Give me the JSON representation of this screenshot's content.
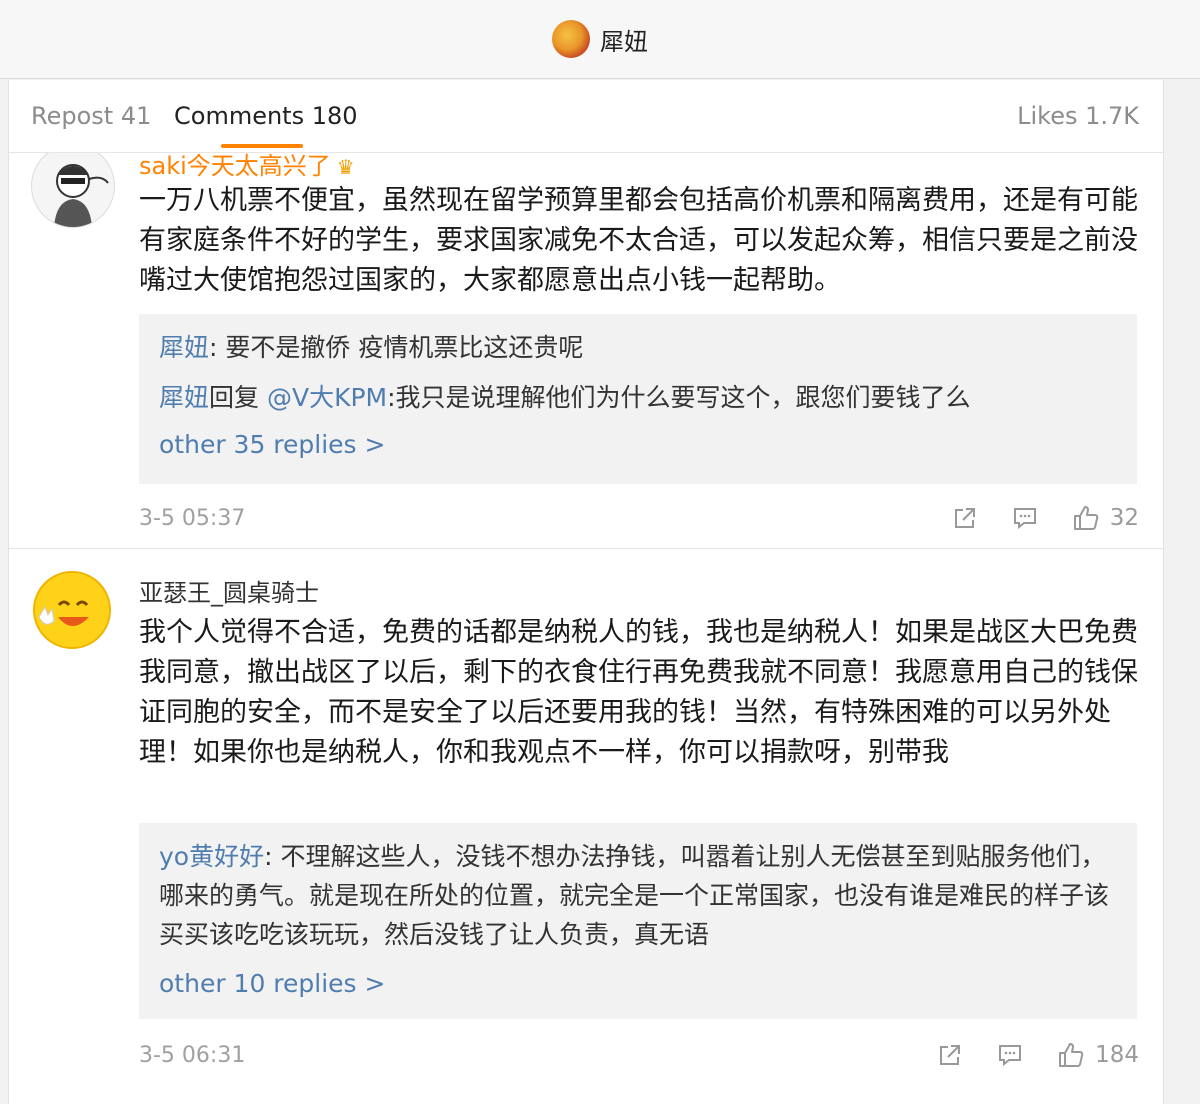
{
  "header": {
    "name": "犀妞"
  },
  "tabs": {
    "repost": "Repost 41",
    "comments": "Comments 180",
    "likes": "Likes 1.7K"
  },
  "comments": [
    {
      "username": "saki今天太高兴了",
      "badge": "crown-icon",
      "text": "一万八机票不便宜，虽然现在留学预算里都会包括高价机票和隔离费用，还是有可能有家庭条件不好的学生，要求国家减免不太合适，可以发起众筹，相信只要是之前没嘴过大使馆抱怨过国家的，大家都愿意出点小钱一起帮助。",
      "replies": [
        {
          "name": "犀妞",
          "text": ": 要不是撤侨  疫情机票比这还贵呢"
        },
        {
          "name": "犀妞",
          "text": "回复 ",
          "mention": "@V大KPM",
          "text2": ":我只是说理解他们为什么要写这个，跟您们要钱了么"
        }
      ],
      "more": "other 35 replies >",
      "time": "3-5 05:37",
      "likes": "32"
    },
    {
      "username": "亚瑟王_圆桌骑士",
      "text": "我个人觉得不合适，免费的话都是纳税人的钱，我也是纳税人！如果是战区大巴免费我同意，撤出战区了以后，剩下的衣食住行再免费我就不同意！我愿意用自己的钱保证同胞的安全，而不是安全了以后还要用我的钱！当然，有特殊困难的可以另外处理！如果你也是纳税人，你和我观点不一样，你可以捐款呀，别带我",
      "replies": [
        {
          "name": "yo黄好好",
          "text": ": 不理解这些人，没钱不想办法挣钱，叫嚣着让别人无偿甚至到贴服务他们，哪来的勇气。就是现在所处的位置，就完全是一个正常国家，也没有谁是难民的样子该买买该吃吃该玩玩，然后没钱了让人负责，真无语"
        }
      ],
      "more": "other 10 replies >",
      "time": "3-5 06:31",
      "likes": "184"
    }
  ],
  "icons": {
    "repost": "share-icon",
    "comment": "comment-icon",
    "like": "thumbs-up-icon"
  },
  "colors": {
    "accent": "#ff8200",
    "link": "#507daf"
  }
}
